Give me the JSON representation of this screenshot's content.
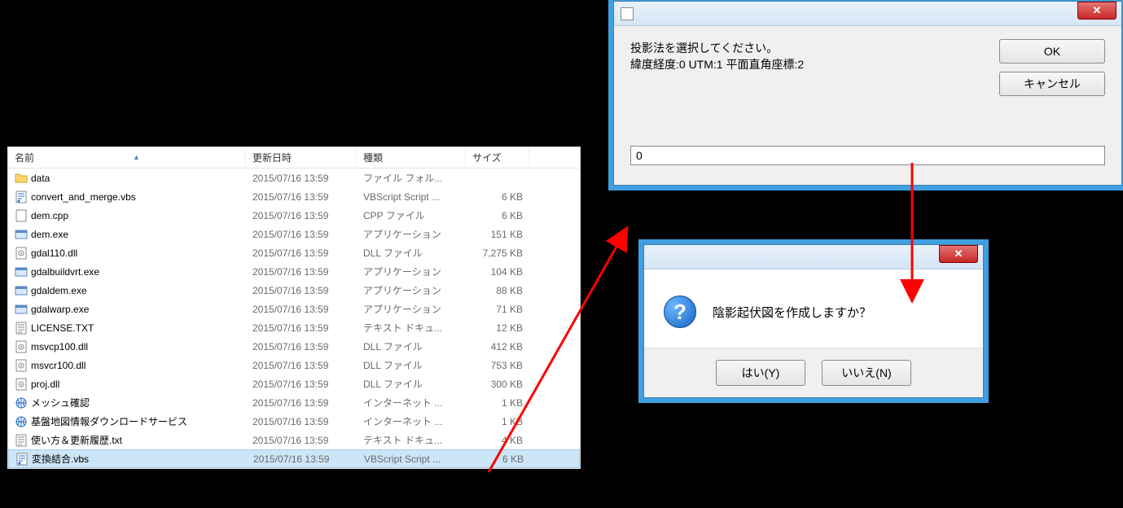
{
  "explorer": {
    "columns": {
      "name": "名前",
      "date": "更新日時",
      "type": "種類",
      "size": "サイズ"
    },
    "rows": [
      {
        "icon": "folder",
        "name": "data",
        "date": "2015/07/16 13:59",
        "type": "ファイル フォル...",
        "size": ""
      },
      {
        "icon": "vbs",
        "name": "convert_and_merge.vbs",
        "date": "2015/07/16 13:59",
        "type": "VBScript Script ...",
        "size": "6 KB"
      },
      {
        "icon": "file",
        "name": "dem.cpp",
        "date": "2015/07/16 13:59",
        "type": "CPP ファイル",
        "size": "6 KB"
      },
      {
        "icon": "exe",
        "name": "dem.exe",
        "date": "2015/07/16 13:59",
        "type": "アプリケーション",
        "size": "151 KB"
      },
      {
        "icon": "dll",
        "name": "gdal110.dll",
        "date": "2015/07/16 13:59",
        "type": "DLL ファイル",
        "size": "7,275 KB"
      },
      {
        "icon": "exe",
        "name": "gdalbuildvrt.exe",
        "date": "2015/07/16 13:59",
        "type": "アプリケーション",
        "size": "104 KB"
      },
      {
        "icon": "exe",
        "name": "gdaldem.exe",
        "date": "2015/07/16 13:59",
        "type": "アプリケーション",
        "size": "88 KB"
      },
      {
        "icon": "exe",
        "name": "gdalwarp.exe",
        "date": "2015/07/16 13:59",
        "type": "アプリケーション",
        "size": "71 KB"
      },
      {
        "icon": "txt",
        "name": "LICENSE.TXT",
        "date": "2015/07/16 13:59",
        "type": "テキスト ドキュ...",
        "size": "12 KB"
      },
      {
        "icon": "dll",
        "name": "msvcp100.dll",
        "date": "2015/07/16 13:59",
        "type": "DLL ファイル",
        "size": "412 KB"
      },
      {
        "icon": "dll",
        "name": "msvcr100.dll",
        "date": "2015/07/16 13:59",
        "type": "DLL ファイル",
        "size": "753 KB"
      },
      {
        "icon": "dll",
        "name": "proj.dll",
        "date": "2015/07/16 13:59",
        "type": "DLL ファイル",
        "size": "300 KB"
      },
      {
        "icon": "html",
        "name": "メッシュ確認",
        "date": "2015/07/16 13:59",
        "type": "インターネット ...",
        "size": "1 KB"
      },
      {
        "icon": "html",
        "name": "基盤地図情報ダウンロードサービス",
        "date": "2015/07/16 13:59",
        "type": "インターネット ...",
        "size": "1 KB"
      },
      {
        "icon": "txt",
        "name": "使い方＆更新履歴.txt",
        "date": "2015/07/16 13:59",
        "type": "テキスト ドキュ...",
        "size": "4 KB"
      },
      {
        "icon": "vbs",
        "name": "変換結合.vbs",
        "date": "2015/07/16 13:59",
        "type": "VBScript Script ...",
        "size": "6 KB",
        "selected": true
      }
    ]
  },
  "dialog1": {
    "prompt_line1": "投影法を選択してください。",
    "prompt_line2": "緯度経度:0 UTM:1 平面直角座標:2",
    "ok": "OK",
    "cancel": "キャンセル",
    "input_value": "0"
  },
  "dialog2": {
    "message": "陰影起伏図を作成しますか？",
    "yes": "はい(Y)",
    "no": "いいえ(N)"
  }
}
